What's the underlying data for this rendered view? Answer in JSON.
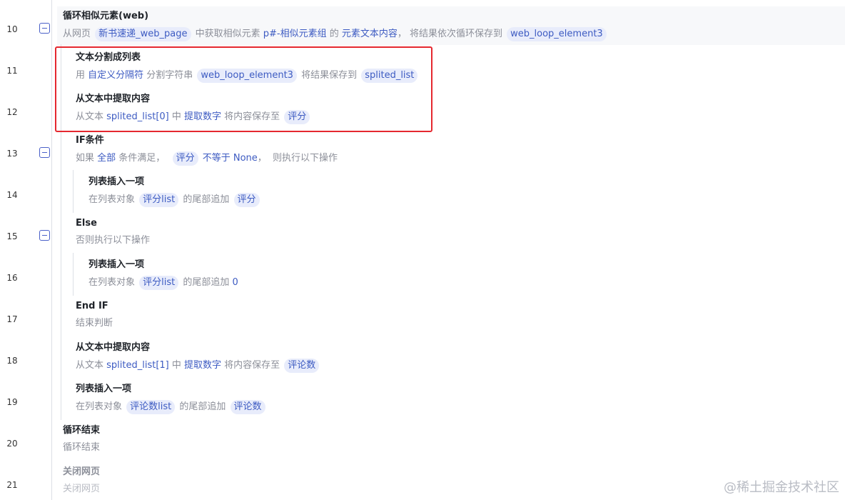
{
  "line_numbers": [
    "10",
    "11",
    "12",
    "13",
    "14",
    "15",
    "16",
    "17",
    "18",
    "19",
    "20",
    "21"
  ],
  "steps": {
    "s10": {
      "title": "循环相似元素(web)",
      "desc": [
        {
          "t": "从网页 ",
          "k": "text"
        },
        {
          "t": "新书速递_web_page",
          "k": "chip"
        },
        {
          "t": " 中获取相似元素 ",
          "k": "text"
        },
        {
          "t": "p#-相似元素组",
          "k": "tok"
        },
        {
          "t": " 的 ",
          "k": "text"
        },
        {
          "t": "元素文本内容",
          "k": "tok"
        },
        {
          "t": "， 将结果依次循环保存到 ",
          "k": "text"
        },
        {
          "t": "web_loop_element3",
          "k": "chip"
        }
      ]
    },
    "s11": {
      "title": "文本分割成列表",
      "desc": [
        {
          "t": "用 ",
          "k": "text"
        },
        {
          "t": "自定义分隔符",
          "k": "tok"
        },
        {
          "t": " 分割字符串 ",
          "k": "text"
        },
        {
          "t": "web_loop_element3",
          "k": "chip"
        },
        {
          "t": " 将结果保存到 ",
          "k": "text"
        },
        {
          "t": "splited_list",
          "k": "chip"
        }
      ]
    },
    "s12": {
      "title": "从文本中提取内容",
      "desc": [
        {
          "t": "从文本 ",
          "k": "text"
        },
        {
          "t": "splited_list[0]",
          "k": "tok"
        },
        {
          "t": " 中 ",
          "k": "text"
        },
        {
          "t": "提取数字",
          "k": "tok"
        },
        {
          "t": " 将内容保存至 ",
          "k": "text"
        },
        {
          "t": "评分",
          "k": "chip"
        }
      ]
    },
    "s13": {
      "title": "IF条件",
      "desc": [
        {
          "t": "如果 ",
          "k": "text"
        },
        {
          "t": "全部",
          "k": "tok"
        },
        {
          "t": " 条件满足，  ",
          "k": "text"
        },
        {
          "t": "评分",
          "k": "chip"
        },
        {
          "t": " 不等于 ",
          "k": "tok"
        },
        {
          "t": "None",
          "k": "tok"
        },
        {
          "t": "，  则执行以下操作",
          "k": "text"
        }
      ]
    },
    "s14": {
      "title": "列表插入一项",
      "desc": [
        {
          "t": "在列表对象 ",
          "k": "text"
        },
        {
          "t": "评分list",
          "k": "chip"
        },
        {
          "t": " 的尾部追加 ",
          "k": "text"
        },
        {
          "t": "评分",
          "k": "chip"
        }
      ]
    },
    "s15": {
      "title": "Else",
      "desc": [
        {
          "t": "否则执行以下操作",
          "k": "text"
        }
      ]
    },
    "s16": {
      "title": "列表插入一项",
      "desc": [
        {
          "t": "在列表对象 ",
          "k": "text"
        },
        {
          "t": "评分list",
          "k": "chip"
        },
        {
          "t": " 的尾部追加 ",
          "k": "text"
        },
        {
          "t": "0",
          "k": "tok"
        }
      ]
    },
    "s17": {
      "title": "End IF",
      "desc": [
        {
          "t": "结束判断",
          "k": "text"
        }
      ]
    },
    "s18": {
      "title": "从文本中提取内容",
      "desc": [
        {
          "t": "从文本 ",
          "k": "text"
        },
        {
          "t": "splited_list[1]",
          "k": "tok"
        },
        {
          "t": " 中 ",
          "k": "text"
        },
        {
          "t": "提取数字",
          "k": "tok"
        },
        {
          "t": " 将内容保存至 ",
          "k": "text"
        },
        {
          "t": "评论数",
          "k": "chip"
        }
      ]
    },
    "s19": {
      "title": "列表插入一项",
      "desc": [
        {
          "t": "在列表对象 ",
          "k": "text"
        },
        {
          "t": "评论数list",
          "k": "chip"
        },
        {
          "t": " 的尾部追加 ",
          "k": "text"
        },
        {
          "t": "评论数",
          "k": "chip"
        }
      ]
    },
    "s20": {
      "title": "循环结束",
      "desc": [
        {
          "t": "循环结束",
          "k": "text"
        }
      ]
    },
    "s21": {
      "title": "关闭网页",
      "desc": [
        {
          "t": "关闭网页",
          "k": "text"
        }
      ]
    }
  },
  "watermark": "@稀土掘金技术社区",
  "colors": {
    "accent": "#3d5bc2",
    "chip_bg": "#e8ecfb",
    "highlight_box": "#e5282f"
  }
}
